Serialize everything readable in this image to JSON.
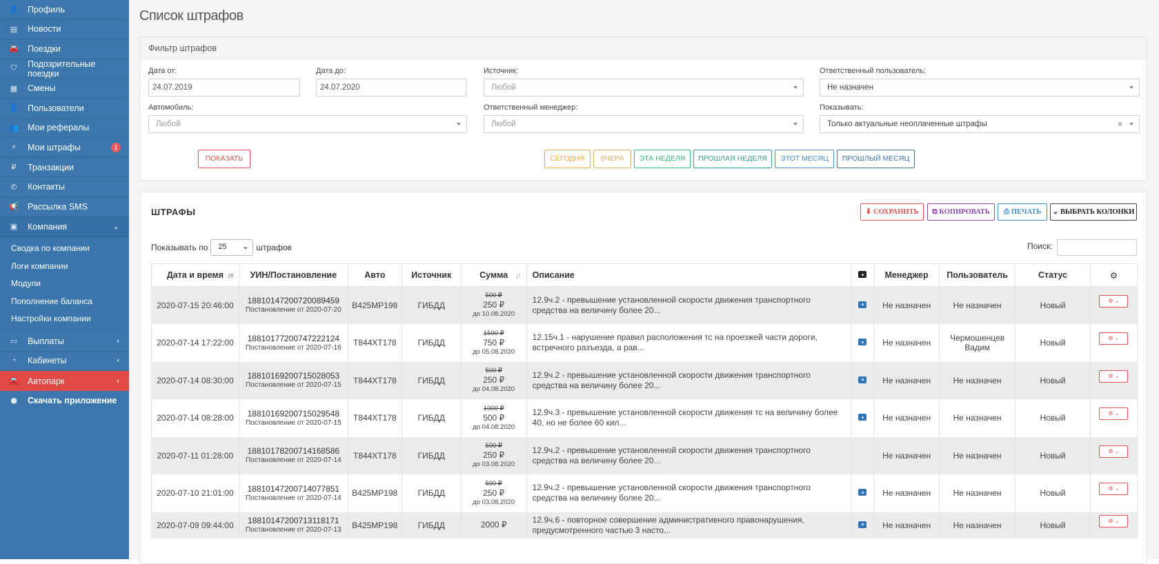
{
  "sidebar": {
    "items": [
      {
        "icon": "user-icon",
        "glyph": "👤",
        "label": "Профиль"
      },
      {
        "icon": "newspaper-icon",
        "glyph": "▤",
        "label": "Новости"
      },
      {
        "icon": "car-icon",
        "glyph": "🚘",
        "label": "Поездки"
      },
      {
        "icon": "shield-icon",
        "glyph": "⛉",
        "label": "Подозрительные поездки"
      },
      {
        "icon": "calendar-icon",
        "glyph": "▦",
        "label": "Смены"
      },
      {
        "icon": "user-icon",
        "glyph": "👤",
        "label": "Пользователи"
      },
      {
        "icon": "users-icon",
        "glyph": "👥",
        "label": "Мои рефералы"
      },
      {
        "icon": "bolt-icon",
        "glyph": "⚡",
        "label": "Мои штрафы",
        "badge": "1"
      },
      {
        "icon": "ruble-icon",
        "glyph": "₽",
        "label": "Транзакции"
      },
      {
        "icon": "phone-icon",
        "glyph": "✆",
        "label": "Контакты"
      },
      {
        "icon": "bullhorn-icon",
        "glyph": "📢",
        "label": "Рассылка SMS"
      }
    ],
    "company": {
      "label": "Компания",
      "caret": "⌄"
    },
    "company_sub": [
      "Сводка по компании",
      "Логи компании",
      "Модули",
      "Пополнение баланса",
      "Настройки компании"
    ],
    "payouts": {
      "label": "Выплаты",
      "caret": "‹"
    },
    "cabinets": {
      "label": "Кабинеты",
      "caret": "‹"
    },
    "fleet": {
      "label": "Автопарк",
      "caret": "‹"
    },
    "download": {
      "label": "Скачать приложение"
    }
  },
  "page_title": "Список штрафов",
  "filter": {
    "title": "Фильтр штрафов",
    "date_from_label": "Дата от:",
    "date_from": "24.07.2019",
    "date_to_label": "Дата до:",
    "date_to": "24.07.2020",
    "source_label": "Источник:",
    "source": "Любой",
    "responsible_user_label": "Ответственный пользователь:",
    "responsible_user": "Не назначен",
    "car_label": "Автомобиль:",
    "car": "Любой",
    "manager_label": "Ответственный менеджер:",
    "manager": "Любой",
    "show_label": "Показывать:",
    "show": "Только актуальные неоплаченные штрафы",
    "clear_symbol": "×",
    "show_button": "ПОКАЗАТЬ",
    "quick": [
      "СЕГОДНЯ",
      "ВЧЕРА",
      "ЭТА НЕДЕЛЯ",
      "ПРОШЛАЯ НЕДЕЛЯ",
      "ЭТОТ МЕСЯЦ",
      "ПРОШЛЫЙ МЕСЯЦ"
    ]
  },
  "fines": {
    "title": "ШТРАФЫ",
    "save": "СОХРАНИТЬ",
    "copy": "КОПИРОВАТЬ",
    "print": "ПЕЧАТЬ",
    "columns_btn": "ВЫБРАТЬ КОЛОНКИ",
    "show_by_prefix": "Показывать по",
    "page_size": "25",
    "show_by_suffix": "штрафов",
    "search_label": "Поиск:",
    "headers": [
      "Дата и время",
      "УИН/Постановление",
      "Авто",
      "Источник",
      "Сумма",
      "Описание",
      "",
      "Менеджер",
      "Пользователь",
      "Статус",
      ""
    ],
    "rows": [
      {
        "datetime": "2020-07-15 20:46:00",
        "uin": "18810147200720089459",
        "decree": "Постановление от 2020-07-20",
        "car": "В425МР198",
        "source": "ГИБДД",
        "old_sum": "500 ₽",
        "sum": "250 ₽",
        "due": "до 10.08.2020",
        "description": "12.9ч.2 - превышение установленной скорости движения транспортного средства на величину более 20...",
        "photo": true,
        "manager": "Не назначен",
        "user": "Не назначен",
        "status": "Новый"
      },
      {
        "datetime": "2020-07-14 17:22:00",
        "uin": "18810177200747222124",
        "decree": "Постановление от 2020-07-16",
        "car": "Т844ХТ178",
        "source": "ГИБДД",
        "old_sum": "1500 ₽",
        "sum": "750 ₽",
        "due": "до 05.08.2020",
        "description": "12.15ч.1 - нарушение правил расположения тс на проезжей части дороги, встречного разъезда, а рав...",
        "photo": true,
        "manager": "Не назначен",
        "user": "Чермошенцев Вадим",
        "status": "Новый"
      },
      {
        "datetime": "2020-07-14 08:30:00",
        "uin": "18810169200715028053",
        "decree": "Постановление от 2020-07-15",
        "car": "Т844ХТ178",
        "source": "ГИБДД",
        "old_sum": "500 ₽",
        "sum": "250 ₽",
        "due": "до 04.08.2020",
        "description": "12.9ч.2 - превышение установленной скорости движения транспортного средства на величину более 20...",
        "photo": true,
        "manager": "Не назначен",
        "user": "Не назначен",
        "status": "Новый"
      },
      {
        "datetime": "2020-07-14 08:28:00",
        "uin": "18810169200715029548",
        "decree": "Постановление от 2020-07-15",
        "car": "Т844ХТ178",
        "source": "ГИБДД",
        "old_sum": "1000 ₽",
        "sum": "500 ₽",
        "due": "до 04.08.2020",
        "description": "12.9ч.3 - превышение установленной скорости движения тс на величину более 40, но не более 60 кил...",
        "photo": true,
        "manager": "Не назначен",
        "user": "Не назначен",
        "status": "Новый"
      },
      {
        "datetime": "2020-07-11 01:28:00",
        "uin": "18810178200714168586",
        "decree": "Постановление от 2020-07-14",
        "car": "Т844ХТ178",
        "source": "ГИБДД",
        "old_sum": "500 ₽",
        "sum": "250 ₽",
        "due": "до 03.08.2020",
        "description": "12.9ч.2 - превышение установленной скорости движения транспортного средства на величину более 20...",
        "photo": false,
        "manager": "Не назначен",
        "user": "Не назначен",
        "status": "Новый"
      },
      {
        "datetime": "2020-07-10 21:01:00",
        "uin": "18810147200714077851",
        "decree": "Постановление от 2020-07-14",
        "car": "В425МР198",
        "source": "ГИБДД",
        "old_sum": "500 ₽",
        "sum": "250 ₽",
        "due": "до 03.08.2020",
        "description": "12.9ч.2 - превышение установленной скорости движения транспортного средства на величину более 20...",
        "photo": true,
        "manager": "Не назначен",
        "user": "Не назначен",
        "status": "Новый"
      },
      {
        "datetime": "2020-07-09 09:44:00",
        "uin": "18810147200713118171",
        "decree": "Постановление от 2020-07-13",
        "car": "В425МР198",
        "source": "ГИБДД",
        "old_sum": "",
        "sum": "2000 ₽",
        "due": "",
        "description": "12.9ч.6 - повторное совершение административного правонарушения, предусмотренного частью 3 насто...",
        "photo": true,
        "manager": "Не назначен",
        "user": "Не назначен",
        "status": "Новый"
      }
    ]
  },
  "colors": {
    "sidebar": "#3b77ad",
    "active": "#e04a44",
    "danger": "#d9534f"
  }
}
